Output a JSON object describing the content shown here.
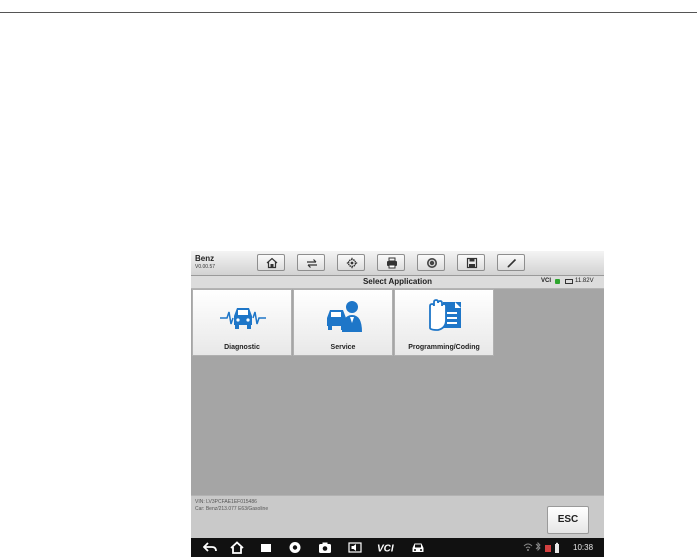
{
  "toolbar": {
    "vehicle_name": "Benz",
    "vehicle_version": "V0.00.57",
    "buttons": [
      "home-icon",
      "vehicle-swap-icon",
      "settings-icon",
      "print-icon",
      "help-icon",
      "save-icon",
      "pen-icon"
    ]
  },
  "titlebar": {
    "title": "Select Application",
    "vci_label": "VCI",
    "battery": "11.82V"
  },
  "apps": [
    {
      "label": "Diagnostic",
      "icon": "car-pulse-icon"
    },
    {
      "label": "Service",
      "icon": "car-technician-icon"
    },
    {
      "label": "Programming/Coding",
      "icon": "hand-document-icon"
    }
  ],
  "info": {
    "vin": "VIN: LV3PCFAE1EF015486",
    "car": "Car: Benz/213.077 E63/Gasoline"
  },
  "esc_label": "ESC",
  "statusbar": {
    "time": "10:38"
  },
  "colors": {
    "workspace": "#a5a5a5",
    "accent_blue": "#1e76c8",
    "vci_green": "#2ea52e",
    "navbar": "#111111"
  }
}
